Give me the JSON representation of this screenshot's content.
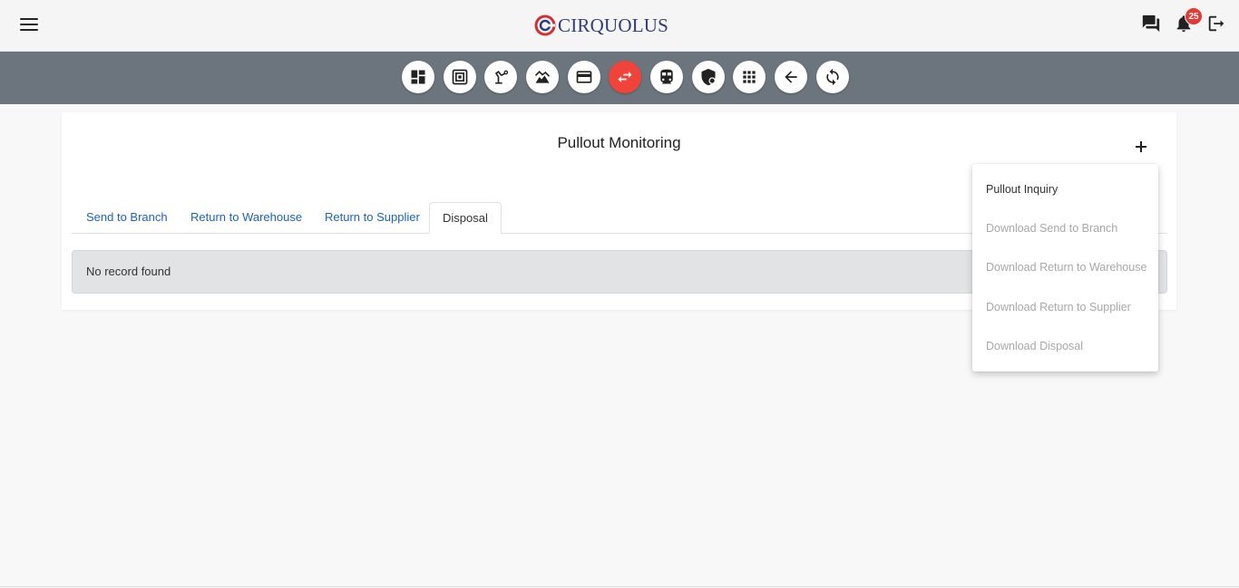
{
  "header": {
    "brand_name": "CIRQUOLUS",
    "notification_count": "25",
    "icons": {
      "menu": "hamburger-menu-icon",
      "chat": "chat-icon",
      "notifications": "bell-icon",
      "logout": "logout-icon"
    }
  },
  "toolbar": {
    "active_color": "#f0443a",
    "bar_color": "#6c757d",
    "buttons": [
      {
        "icon": "dashboard-icon",
        "active": false
      },
      {
        "icon": "memory-chip-icon",
        "active": false
      },
      {
        "icon": "precision-tool-icon",
        "active": false
      },
      {
        "icon": "landscape-icon",
        "active": false
      },
      {
        "icon": "credit-card-icon",
        "active": false
      },
      {
        "icon": "swap-arrows-icon",
        "active": true
      },
      {
        "icon": "train-icon",
        "active": false
      },
      {
        "icon": "shield-lock-icon",
        "active": false
      },
      {
        "icon": "apps-grid-icon",
        "active": false
      },
      {
        "icon": "arrow-back-icon",
        "active": false
      },
      {
        "icon": "sync-icon",
        "active": false
      }
    ]
  },
  "page": {
    "title": "Pullout Monitoring",
    "tabs": [
      {
        "label": "Send to Branch",
        "active": false
      },
      {
        "label": "Return to Warehouse",
        "active": false
      },
      {
        "label": "Return to Supplier",
        "active": false
      },
      {
        "label": "Disposal",
        "active": true
      }
    ],
    "empty_message": "No record found"
  },
  "dropdown": {
    "items": [
      {
        "label": "Pullout Inquiry",
        "enabled": true
      },
      {
        "label": "Download Send to Branch",
        "enabled": false
      },
      {
        "label": "Download Return to Warehouse",
        "enabled": false
      },
      {
        "label": "Download Return to Supplier",
        "enabled": false
      },
      {
        "label": "Download Disposal",
        "enabled": false
      }
    ]
  }
}
